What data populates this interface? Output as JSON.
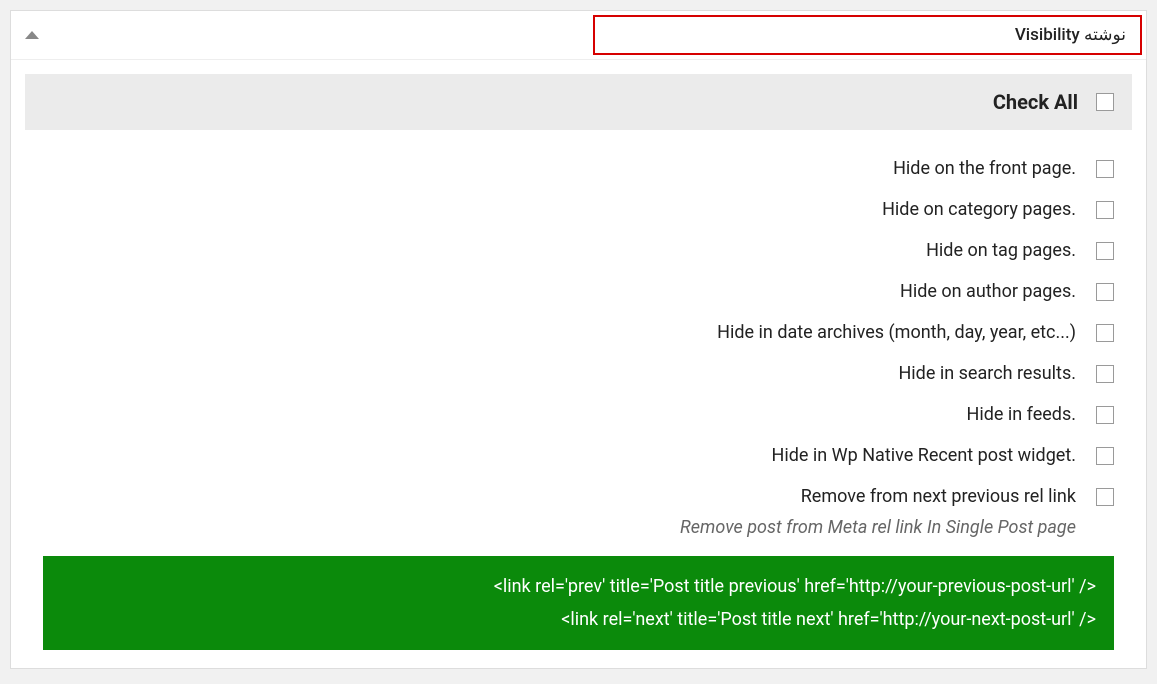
{
  "header": {
    "title": "نوشته Visibility"
  },
  "checkAll": {
    "label": "Check All"
  },
  "options": {
    "items": [
      {
        "label": ".Hide on the front page"
      },
      {
        "label": ".Hide on category pages"
      },
      {
        "label": ".Hide on tag pages"
      },
      {
        "label": ".Hide on author pages"
      },
      {
        "label": "(...Hide in date archives (month, day, year, etc"
      },
      {
        "label": ".Hide in search results"
      },
      {
        "label": ".Hide in feeds"
      },
      {
        "label": ".Hide in Wp Native Recent post widget"
      },
      {
        "label": "Remove from next previous rel link",
        "desc": "Remove post from Meta rel link In Single Post page"
      }
    ]
  },
  "code": {
    "line1": "</ 'link rel='prev' title='Post title previous' href='http://your-previous-post-url>",
    "line2": "</ 'link rel='next' title='Post title next' href='http://your-next-post-url>"
  }
}
